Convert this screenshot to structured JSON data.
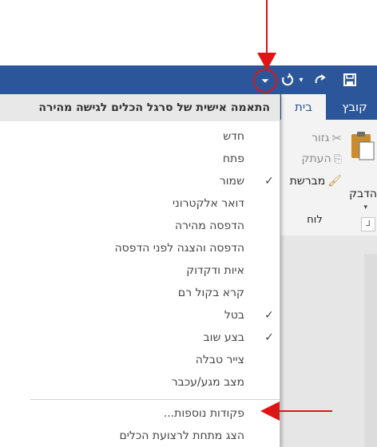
{
  "colors": {
    "word_blue": "#2b579a",
    "arrow_red": "#e01414"
  },
  "qat": {
    "save_icon": "save-icon",
    "redo_icon": "redo-icon",
    "undo_icon": "undo-icon",
    "customize_glyph": "⏷"
  },
  "ribbon": {
    "tabs": [
      {
        "label": "קובץ"
      },
      {
        "label": "בית"
      }
    ],
    "paste_label": "הדבק",
    "cut_label": "גזור",
    "copy_label": "העתק",
    "format_painter_label": "מברשת",
    "group_label": "לוח"
  },
  "menu": {
    "header": "התאמה אישית של סרגל הכלים לגישה מהירה",
    "items": [
      {
        "label": "חדש",
        "checked": false
      },
      {
        "label": "פתח",
        "checked": false
      },
      {
        "label": "שמור",
        "checked": true
      },
      {
        "label": "דואר אלקטרוני",
        "checked": false
      },
      {
        "label": "הדפסה מהירה",
        "checked": false
      },
      {
        "label": "הדפסה והצגה לפני הדפסה",
        "checked": false
      },
      {
        "label": "איות ודקדוק",
        "checked": false
      },
      {
        "label": "קרא בקול רם",
        "checked": false
      },
      {
        "label": "בטל",
        "checked": true
      },
      {
        "label": "בצע שוב",
        "checked": true
      },
      {
        "label": "צייר טבלה",
        "checked": false
      },
      {
        "label": "מצב מגע/עכבר",
        "checked": false
      }
    ],
    "more_commands": "פקודות נוספות...",
    "show_below": "הצג מתחת לרצועת הכלים",
    "check_glyph": "✓"
  }
}
